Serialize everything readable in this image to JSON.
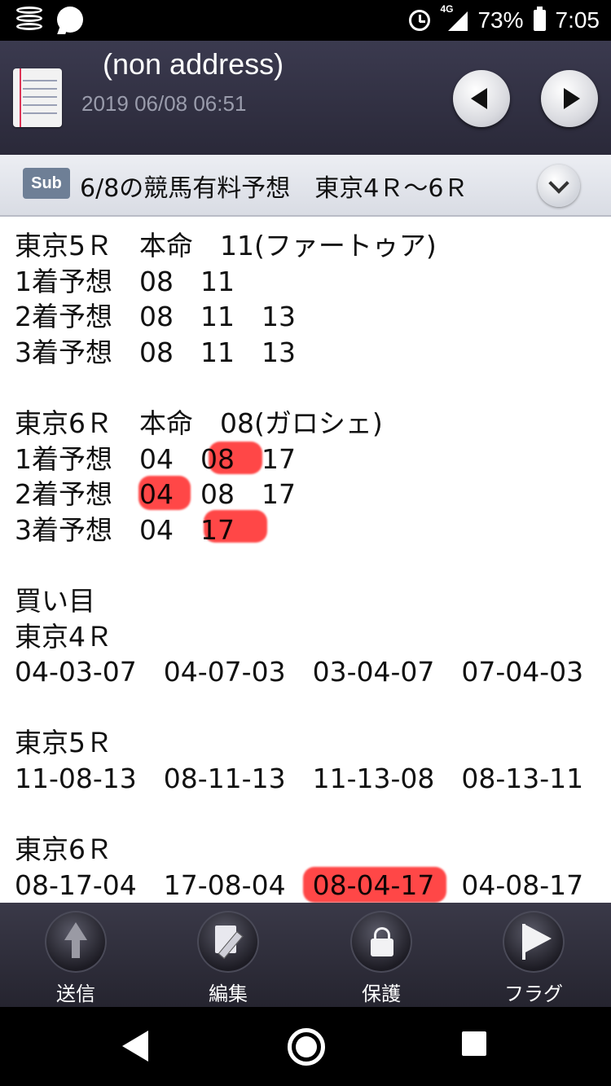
{
  "status_bar": {
    "network": "4G",
    "battery": "73%",
    "time": "7:05"
  },
  "header": {
    "title": "(non address)",
    "datetime": "2019 06/08 06:51"
  },
  "subject": {
    "badge": "Sub",
    "text": "6/8の競馬有料予想　東京4Ｒ～6Ｒ"
  },
  "body": {
    "text": "東京5Ｒ　本命　11(ファートゥア)\n1着予想　08　11\n2着予想　08　11　13\n3着予想　08　11　13\n\n東京6Ｒ　本命　08(ガロシェ)\n1着予想　04　08　17\n2着予想　04　08　17\n3着予想　04　17\n\n買い目\n東京4Ｒ\n04-03-07　04-07-03　03-04-07　07-04-03\n\n東京5Ｒ\n11-08-13　08-11-13　11-13-08　08-13-11\n\n東京6Ｒ\n08-17-04　17-08-04　08-04-17　04-08-17"
  },
  "highlight_color": "#ff0000",
  "toolbar": {
    "send": "送信",
    "edit": "編集",
    "protect": "保護",
    "flag": "フラグ"
  }
}
